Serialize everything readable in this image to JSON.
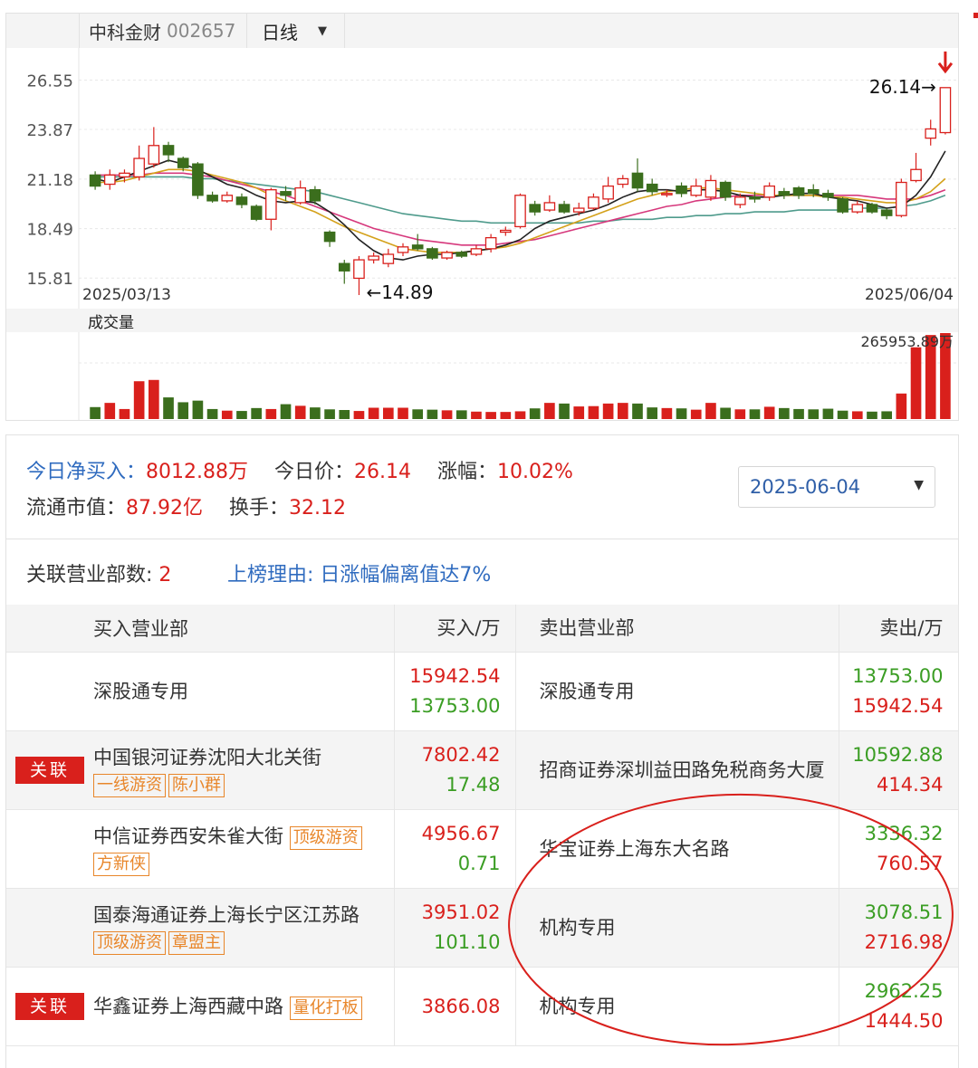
{
  "stock": {
    "name": "中科金财",
    "code": "002657",
    "period": "日线"
  },
  "colors": {
    "up": "#d9201c",
    "down": "#3b6e1d",
    "ma5": "#222222",
    "ma10": "#d4a11a",
    "ma20": "#d6387c",
    "ma60": "#4f9b8c"
  },
  "chart_data": {
    "type": "candlestick",
    "y_ticks": [
      "26.55",
      "23.87",
      "21.18",
      "18.49",
      "15.81"
    ],
    "ylim": [
      14.3,
      27.8
    ],
    "x_start": "2025/03/13",
    "x_end": "2025/06/04",
    "high_label": "26.14→",
    "low_label": "←14.89",
    "volume_label": "成交量",
    "volume_max_label": "265953.89万",
    "candles": [
      {
        "o": 21.4,
        "c": 20.8,
        "h": 21.6,
        "l": 20.6
      },
      {
        "o": 20.9,
        "c": 21.4,
        "h": 21.7,
        "l": 20.6
      },
      {
        "o": 21.3,
        "c": 21.5,
        "h": 21.7,
        "l": 21.0
      },
      {
        "o": 21.3,
        "c": 22.3,
        "h": 23.0,
        "l": 21.1
      },
      {
        "o": 22.0,
        "c": 23.0,
        "h": 24.0,
        "l": 21.8
      },
      {
        "o": 23.0,
        "c": 22.5,
        "h": 23.2,
        "l": 22.1
      },
      {
        "o": 22.3,
        "c": 21.8,
        "h": 22.4,
        "l": 21.6
      },
      {
        "o": 22.0,
        "c": 20.3,
        "h": 22.1,
        "l": 20.1
      },
      {
        "o": 20.3,
        "c": 20.0,
        "h": 20.5,
        "l": 19.9
      },
      {
        "o": 20.0,
        "c": 20.3,
        "h": 20.5,
        "l": 19.9
      },
      {
        "o": 20.2,
        "c": 19.8,
        "h": 20.4,
        "l": 19.6
      },
      {
        "o": 19.7,
        "c": 19.0,
        "h": 19.8,
        "l": 18.9
      },
      {
        "o": 19.0,
        "c": 20.6,
        "h": 20.7,
        "l": 18.4
      },
      {
        "o": 20.5,
        "c": 20.3,
        "h": 20.8,
        "l": 20.0
      },
      {
        "o": 19.9,
        "c": 20.7,
        "h": 21.1,
        "l": 19.8
      },
      {
        "o": 20.6,
        "c": 20.0,
        "h": 20.8,
        "l": 19.8
      },
      {
        "o": 18.3,
        "c": 17.8,
        "h": 18.4,
        "l": 17.5
      },
      {
        "o": 16.6,
        "c": 16.2,
        "h": 16.8,
        "l": 15.5
      },
      {
        "o": 15.8,
        "c": 16.8,
        "h": 17.0,
        "l": 14.89
      },
      {
        "o": 16.8,
        "c": 17.0,
        "h": 17.2,
        "l": 16.6
      },
      {
        "o": 16.6,
        "c": 17.1,
        "h": 17.4,
        "l": 16.4
      },
      {
        "o": 17.2,
        "c": 17.5,
        "h": 17.7,
        "l": 17.0
      },
      {
        "o": 17.6,
        "c": 17.4,
        "h": 18.2,
        "l": 17.3
      },
      {
        "o": 17.4,
        "c": 16.9,
        "h": 17.5,
        "l": 16.8
      },
      {
        "o": 16.9,
        "c": 17.2,
        "h": 17.3,
        "l": 16.8
      },
      {
        "o": 17.2,
        "c": 17.0,
        "h": 17.3,
        "l": 16.9
      },
      {
        "o": 17.1,
        "c": 17.4,
        "h": 17.6,
        "l": 17.0
      },
      {
        "o": 17.4,
        "c": 18.0,
        "h": 18.2,
        "l": 17.2
      },
      {
        "o": 18.3,
        "c": 18.4,
        "h": 18.6,
        "l": 18.1
      },
      {
        "o": 18.6,
        "c": 20.3,
        "h": 20.4,
        "l": 18.5
      },
      {
        "o": 19.8,
        "c": 19.4,
        "h": 20.0,
        "l": 19.2
      },
      {
        "o": 19.5,
        "c": 19.9,
        "h": 20.3,
        "l": 19.4
      },
      {
        "o": 19.8,
        "c": 19.4,
        "h": 20.0,
        "l": 19.3
      },
      {
        "o": 19.4,
        "c": 19.6,
        "h": 19.9,
        "l": 19.2
      },
      {
        "o": 19.6,
        "c": 20.2,
        "h": 20.4,
        "l": 19.5
      },
      {
        "o": 20.1,
        "c": 20.8,
        "h": 21.3,
        "l": 19.9
      },
      {
        "o": 20.9,
        "c": 21.2,
        "h": 21.4,
        "l": 20.7
      },
      {
        "o": 21.5,
        "c": 20.7,
        "h": 22.3,
        "l": 20.5
      },
      {
        "o": 20.9,
        "c": 20.5,
        "h": 21.2,
        "l": 20.3
      },
      {
        "o": 20.4,
        "c": 20.4,
        "h": 20.6,
        "l": 20.2
      },
      {
        "o": 20.8,
        "c": 20.4,
        "h": 21.0,
        "l": 20.2
      },
      {
        "o": 20.3,
        "c": 20.8,
        "h": 21.2,
        "l": 20.2
      },
      {
        "o": 20.2,
        "c": 21.1,
        "h": 21.4,
        "l": 20.0
      },
      {
        "o": 21.0,
        "c": 20.2,
        "h": 21.1,
        "l": 20.0
      },
      {
        "o": 19.8,
        "c": 20.2,
        "h": 20.4,
        "l": 19.6
      },
      {
        "o": 20.2,
        "c": 20.1,
        "h": 20.5,
        "l": 19.9
      },
      {
        "o": 20.2,
        "c": 20.8,
        "h": 21.0,
        "l": 20.0
      },
      {
        "o": 20.5,
        "c": 20.3,
        "h": 20.7,
        "l": 20.1
      },
      {
        "o": 20.7,
        "c": 20.3,
        "h": 20.8,
        "l": 20.1
      },
      {
        "o": 20.6,
        "c": 20.4,
        "h": 20.9,
        "l": 20.2
      },
      {
        "o": 20.4,
        "c": 20.2,
        "h": 20.6,
        "l": 20.0
      },
      {
        "o": 20.1,
        "c": 19.4,
        "h": 20.2,
        "l": 19.3
      },
      {
        "o": 19.4,
        "c": 19.8,
        "h": 20.0,
        "l": 19.3
      },
      {
        "o": 19.8,
        "c": 19.4,
        "h": 19.9,
        "l": 19.3
      },
      {
        "o": 19.5,
        "c": 19.2,
        "h": 19.6,
        "l": 19.0
      },
      {
        "o": 19.2,
        "c": 21.0,
        "h": 21.2,
        "l": 19.1
      },
      {
        "o": 21.1,
        "c": 21.7,
        "h": 22.6,
        "l": 21.0
      },
      {
        "o": 23.4,
        "c": 23.9,
        "h": 24.4,
        "l": 23.0
      },
      {
        "o": 23.7,
        "c": 26.14,
        "h": 26.14,
        "l": 23.6
      }
    ],
    "volumes": [
      37,
      50,
      31,
      117,
      121,
      67,
      52,
      57,
      31,
      26,
      25,
      34,
      31,
      46,
      41,
      36,
      30,
      28,
      25,
      35,
      35,
      35,
      30,
      29,
      27,
      27,
      23,
      22,
      22,
      24,
      33,
      50,
      48,
      39,
      40,
      48,
      50,
      48,
      36,
      34,
      33,
      29,
      50,
      35,
      30,
      30,
      38,
      34,
      31,
      30,
      32,
      26,
      24,
      23,
      24,
      79,
      222,
      260,
      266
    ],
    "max_volume": 265953.89,
    "ma5": [
      21.2,
      21.0,
      21.3,
      21.6,
      21.9,
      22.2,
      22.0,
      21.7,
      21.3,
      20.9,
      20.7,
      20.3,
      20.0,
      19.9,
      20.0,
      19.9,
      19.4,
      18.7,
      17.9,
      17.3,
      16.9,
      16.8,
      17.0,
      17.1,
      17.1,
      17.2,
      17.3,
      17.4,
      17.6,
      17.9,
      18.5,
      18.9,
      19.1,
      19.3,
      19.5,
      19.8,
      20.2,
      20.5,
      20.6,
      20.6,
      20.5,
      20.6,
      20.6,
      20.5,
      20.3,
      20.2,
      20.2,
      20.3,
      20.4,
      20.4,
      20.2,
      20.1,
      20.0,
      19.8,
      19.6,
      19.7,
      20.3,
      21.3,
      22.7
    ],
    "ma10": [
      21.0,
      21.0,
      21.1,
      21.3,
      21.5,
      21.7,
      21.7,
      21.6,
      21.4,
      21.2,
      21.0,
      20.7,
      20.3,
      20.0,
      19.7,
      19.4,
      19.0,
      18.6,
      18.3,
      18.0,
      17.7,
      17.4,
      17.3,
      17.2,
      17.2,
      17.2,
      17.3,
      17.4,
      17.5,
      17.7,
      18.0,
      18.3,
      18.6,
      18.9,
      19.2,
      19.5,
      19.8,
      20.1,
      20.3,
      20.5,
      20.6,
      20.7,
      20.7,
      20.6,
      20.5,
      20.4,
      20.3,
      20.3,
      20.3,
      20.3,
      20.2,
      20.2,
      20.1,
      20.0,
      19.9,
      19.9,
      20.1,
      20.5,
      21.2
    ],
    "ma20": [
      21.4,
      21.4,
      21.4,
      21.4,
      21.5,
      21.5,
      21.5,
      21.4,
      21.3,
      21.1,
      20.9,
      20.7,
      20.5,
      20.3,
      20.0,
      19.7,
      19.4,
      19.1,
      18.8,
      18.5,
      18.3,
      18.1,
      17.9,
      17.8,
      17.7,
      17.6,
      17.6,
      17.6,
      17.7,
      17.8,
      17.9,
      18.1,
      18.3,
      18.5,
      18.7,
      18.9,
      19.1,
      19.3,
      19.5,
      19.7,
      19.8,
      20.0,
      20.1,
      20.2,
      20.3,
      20.3,
      20.3,
      20.3,
      20.3,
      20.3,
      20.3,
      20.3,
      20.3,
      20.2,
      20.1,
      20.1,
      20.1,
      20.3,
      20.6
    ],
    "ma60": [
      21.3,
      21.3,
      21.3,
      21.3,
      21.3,
      21.3,
      21.3,
      21.2,
      21.2,
      21.1,
      21.0,
      20.9,
      20.8,
      20.7,
      20.6,
      20.5,
      20.3,
      20.1,
      19.9,
      19.7,
      19.5,
      19.3,
      19.2,
      19.1,
      19.0,
      18.9,
      18.9,
      18.8,
      18.8,
      18.8,
      18.8,
      18.8,
      18.8,
      18.8,
      18.9,
      18.9,
      19.0,
      19.0,
      19.0,
      19.1,
      19.1,
      19.2,
      19.2,
      19.3,
      19.3,
      19.4,
      19.4,
      19.4,
      19.5,
      19.5,
      19.5,
      19.5,
      19.6,
      19.6,
      19.6,
      19.7,
      19.8,
      20.0,
      20.3
    ]
  },
  "summary": {
    "net_buy_label": "今日净买入：",
    "net_buy_value": "8012.88万",
    "price_label": "今日价：",
    "price_value": "26.14",
    "change_label": "涨幅：",
    "change_value": "10.02%",
    "cap_label": "流通市值：",
    "cap_value": "87.92亿",
    "turnover_label": "换手：",
    "turnover_value": "32.12",
    "date": "2025-06-04"
  },
  "assoc": {
    "count_label": "关联营业部数: ",
    "count_value": "2",
    "reason_label": "上榜理由: ",
    "reason_value": "日涨幅偏离值达7%"
  },
  "table": {
    "headers": {
      "buy_branch": "买入营业部",
      "buy_amount": "买入/万",
      "sell_branch": "卖出营业部",
      "sell_amount": "卖出/万"
    },
    "rows": [
      {
        "rel": "",
        "buy": "深股通专用",
        "tags": [],
        "buy_top": "15942.54",
        "buy_bot": "13753.00",
        "sell": "深股通专用",
        "sell_top": "13753.00",
        "sell_bot": "15942.54"
      },
      {
        "rel": "关联",
        "buy": "中国银河证券沈阳大北关街",
        "tags": [
          "一线游资",
          "陈小群"
        ],
        "buy_top": "7802.42",
        "buy_bot": "17.48",
        "sell": "招商证券深圳益田路免税商务大厦",
        "sell_top": "10592.88",
        "sell_bot": "414.34"
      },
      {
        "rel": "",
        "buy": "中信证券西安朱雀大街",
        "tags": [
          "顶级游资",
          "方新侠"
        ],
        "buy_top": "4956.67",
        "buy_bot": "0.71",
        "sell": "华宝证券上海东大名路",
        "sell_top": "3336.32",
        "sell_bot": "760.57"
      },
      {
        "rel": "",
        "buy": "国泰海通证券上海长宁区江苏路",
        "tags": [
          "顶级游资",
          "章盟主"
        ],
        "buy_top": "3951.02",
        "buy_bot": "101.10",
        "sell": "机构专用",
        "sell_top": "3078.51",
        "sell_bot": "2716.98"
      },
      {
        "rel": "关联",
        "buy": "华鑫证券上海西藏中路",
        "tags": [
          "量化打板"
        ],
        "buy_top": "3866.08",
        "buy_bot": "",
        "sell": "机构专用",
        "sell_top": "2962.25",
        "sell_bot": "1444.50"
      }
    ]
  }
}
